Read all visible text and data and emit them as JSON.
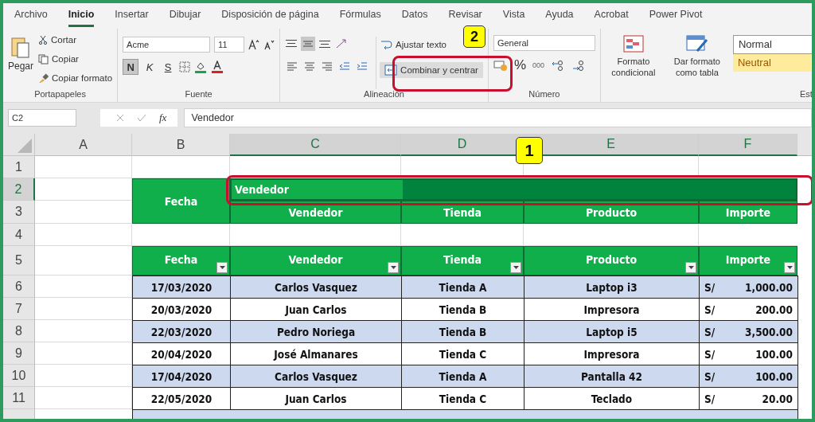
{
  "tabs": [
    {
      "label": "Archivo",
      "selected": false
    },
    {
      "label": "Inicio",
      "selected": true
    },
    {
      "label": "Insertar",
      "selected": false
    },
    {
      "label": "Dibujar",
      "selected": false
    },
    {
      "label": "Disposición de página",
      "selected": false
    },
    {
      "label": "Fórmulas",
      "selected": false
    },
    {
      "label": "Datos",
      "selected": false
    },
    {
      "label": "Revisar",
      "selected": false
    },
    {
      "label": "Vista",
      "selected": false
    },
    {
      "label": "Ayuda",
      "selected": false
    },
    {
      "label": "Acrobat",
      "selected": false
    },
    {
      "label": "Power Pivot",
      "selected": false
    }
  ],
  "ribbon": {
    "clipboard": {
      "paste": "Pegar",
      "cut": "Cortar",
      "copy": "Copiar",
      "format_painter": "Copiar formato",
      "label": "Portapapeles"
    },
    "font": {
      "name": "Acme",
      "size": "11",
      "bold": "N",
      "bold_on": true,
      "italic": "K",
      "underline": "S",
      "label": "Fuente"
    },
    "alignment": {
      "middle_on": true,
      "wrap": "Ajustar texto",
      "merge": "Combinar y centrar",
      "label": "Alineación"
    },
    "number": {
      "format": "General",
      "percent": "%",
      "thousands": "000",
      "label": "Número"
    },
    "styles": {
      "conditional": "Formato condicional",
      "as_table": "Dar formato como tabla",
      "cells": [
        {
          "name": "Normal",
          "kind": "normal"
        },
        {
          "name": "Neutral",
          "kind": "neutral"
        }
      ],
      "label": "Est"
    }
  },
  "formula_bar": {
    "name_box": "C2",
    "function_label": "fx",
    "value": "Vendedor"
  },
  "sheet": {
    "columns": [
      {
        "label": "A",
        "selected": false
      },
      {
        "label": "B",
        "selected": false
      },
      {
        "label": "C",
        "selected": true
      },
      {
        "label": "D",
        "selected": true
      },
      {
        "label": "E",
        "selected": true
      },
      {
        "label": "F",
        "selected": true
      }
    ],
    "rows": [
      {
        "label": "1",
        "selected": false
      },
      {
        "label": "2",
        "selected": true
      },
      {
        "label": "3",
        "selected": false
      },
      {
        "label": "4",
        "selected": false
      },
      {
        "label": "5",
        "selected": false
      },
      {
        "label": "6",
        "selected": false
      },
      {
        "label": "7",
        "selected": false
      },
      {
        "label": "8",
        "selected": false
      },
      {
        "label": "9",
        "selected": false
      },
      {
        "label": "10",
        "selected": false
      },
      {
        "label": "11",
        "selected": false
      }
    ],
    "top_header": {
      "date": "Fecha",
      "merged": "Vendedor",
      "subheaders": [
        "Vendedor",
        "Tienda",
        "Producto",
        "Importe"
      ]
    },
    "table": {
      "columns": [
        "Fecha",
        "Vendedor",
        "Tienda",
        "Producto",
        "Importe"
      ],
      "rows": [
        {
          "date": "17/03/2020",
          "seller": "Carlos Vasquez",
          "store": "Tienda A",
          "product": "Laptop i3",
          "currency": "S/",
          "amount": "1,000.00"
        },
        {
          "date": "20/03/2020",
          "seller": "Juan Carlos",
          "store": "Tienda B",
          "product": "Impresora",
          "currency": "S/",
          "amount": "200.00"
        },
        {
          "date": "22/03/2020",
          "seller": "Pedro Noriega",
          "store": "Tienda B",
          "product": "Laptop i5",
          "currency": "S/",
          "amount": "3,500.00"
        },
        {
          "date": "20/04/2020",
          "seller": "José Almanares",
          "store": "Tienda C",
          "product": "Impresora",
          "currency": "S/",
          "amount": "100.00"
        },
        {
          "date": "17/04/2020",
          "seller": "Carlos Vasquez",
          "store": "Tienda A",
          "product": "Pantalla 42",
          "currency": "S/",
          "amount": "100.00"
        },
        {
          "date": "22/05/2020",
          "seller": "Juan Carlos",
          "store": "Tienda C",
          "product": "Teclado",
          "currency": "S/",
          "amount": "20.00"
        }
      ]
    }
  },
  "annotations": [
    "1",
    "2"
  ]
}
